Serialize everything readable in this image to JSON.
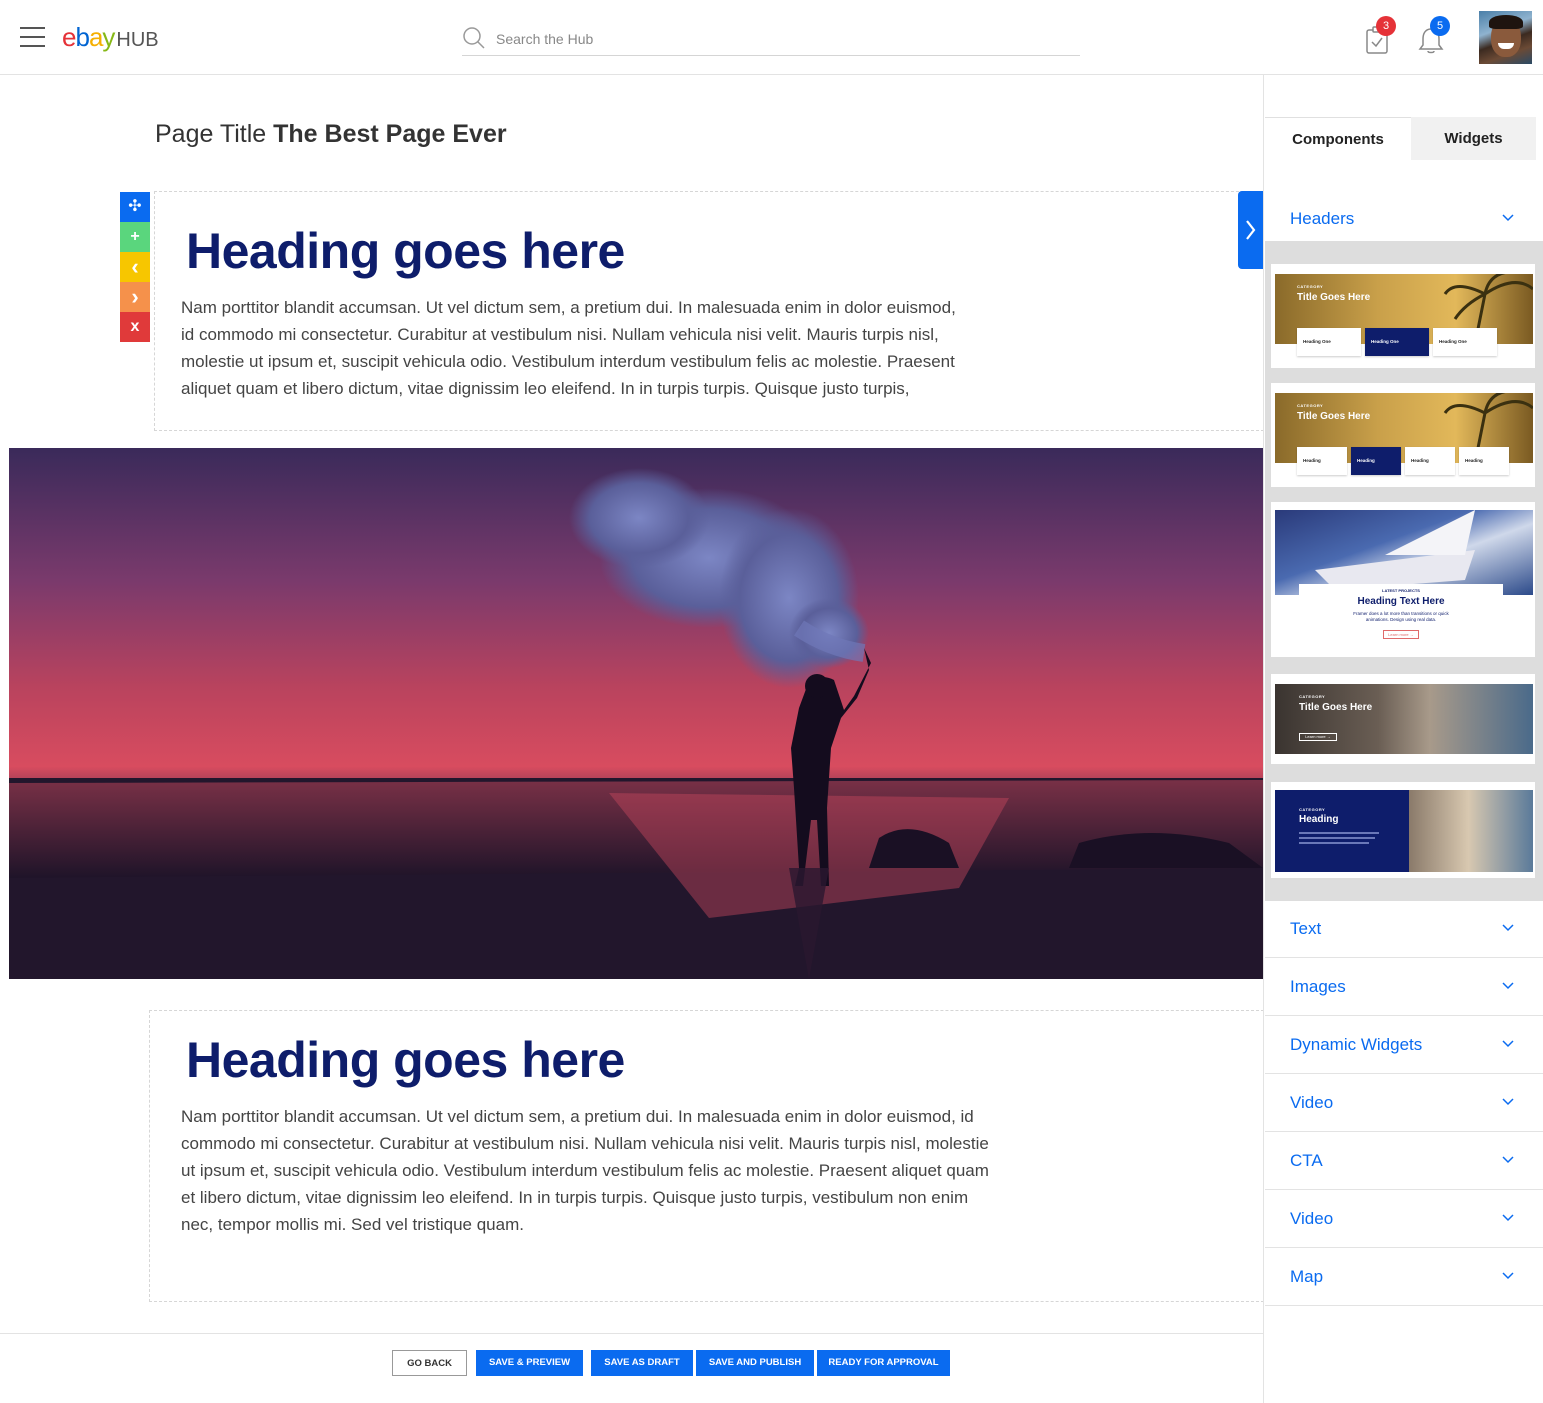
{
  "header": {
    "logo": {
      "e": "e",
      "b": "b",
      "a": "a",
      "y": "y",
      "hub": "HUB"
    },
    "search_placeholder": "Search the Hub",
    "tasks_count": "3",
    "notifications_count": "5",
    "colors": {
      "accent": "#0a6bf0",
      "badge_red": "#e53238",
      "badge_blue": "#0a6bf0"
    }
  },
  "page": {
    "title_prefix": "Page Title",
    "title_value": "The Best Page Ever"
  },
  "blocks": [
    {
      "heading": "Heading goes here",
      "lines": [
        "Nam porttitor blandit accumsan. Ut vel dictum sem, a pretium dui. In malesuada enim in dolor euismod,",
        "id commodo mi consectetur. Curabitur at vestibulum nisi. Nullam vehicula nisi velit. Mauris turpis nisl,",
        "molestie ut ipsum et, suscipit vehicula odio. Vestibulum interdum vestibulum felis ac molestie. Praesent",
        "aliquet quam et libero dictum, vitae dignissim leo eleifend. In in turpis turpis. Quisque justo turpis,"
      ]
    },
    {
      "heading": "Heading goes here",
      "lines": [
        "Nam porttitor blandit accumsan. Ut vel dictum sem, a pretium dui. In malesuada enim in dolor euismod, id",
        "commodo mi consectetur. Curabitur at vestibulum nisi. Nullam vehicula nisi velit. Mauris turpis nisl, molestie",
        "ut ipsum et, suscipit vehicula odio. Vestibulum interdum vestibulum felis ac molestie. Praesent aliquet quam",
        "et libero dictum, vitae dignissim leo eleifend. In in turpis turpis. Quisque justo turpis, vestibulum non enim",
        "nec, tempor mollis mi. Sed vel tristique quam."
      ]
    }
  ],
  "block_tools": [
    {
      "name": "move-icon",
      "glyph": "✣",
      "color": "#0a6bf0"
    },
    {
      "name": "add-icon",
      "glyph": "+",
      "color": "#5ad67d"
    },
    {
      "name": "chevron-left-icon",
      "glyph": "‹",
      "color": "#f7c600"
    },
    {
      "name": "chevron-right-icon",
      "glyph": "›",
      "color": "#f5914b"
    },
    {
      "name": "delete-icon",
      "glyph": "x",
      "color": "#e03a3a"
    }
  ],
  "actions": {
    "go_back": "GO BACK",
    "save_preview": "SAVE & PREVIEW",
    "save_draft": "SAVE AS DRAFT",
    "save_publish": "SAVE AND PUBLISH",
    "ready_approval": "READY FOR APPROVAL"
  },
  "panel": {
    "tabs": [
      "Components",
      "Widgets"
    ],
    "active_tab": "Components",
    "open_section": "Headers",
    "sections": [
      "Text",
      "Images",
      "Dynamic Widgets",
      "Video",
      "CTA",
      "Video",
      "Map"
    ],
    "thumbnails": {
      "t1": {
        "category": "CATEGORY",
        "title": "Title Goes Here",
        "cards": [
          "Heading One",
          "Heading One",
          "Heading One"
        ]
      },
      "t2": {
        "category": "CATEGORY",
        "title": "Title Goes Here",
        "cards": [
          "Heading",
          "Heading",
          "Heading",
          "Heading"
        ]
      },
      "t3": {
        "category": "LATEST PROJECTS",
        "title": "Heading Text Here",
        "body": "Framer does a lot more than transitions or quick animations. Design using real data.",
        "link": "Learn more →"
      },
      "t4": {
        "category": "CATEGORY",
        "title": "Title Goes Here",
        "link": "Learn more →"
      },
      "t5": {
        "category": "CATEGORY",
        "title": "Heading"
      }
    }
  }
}
